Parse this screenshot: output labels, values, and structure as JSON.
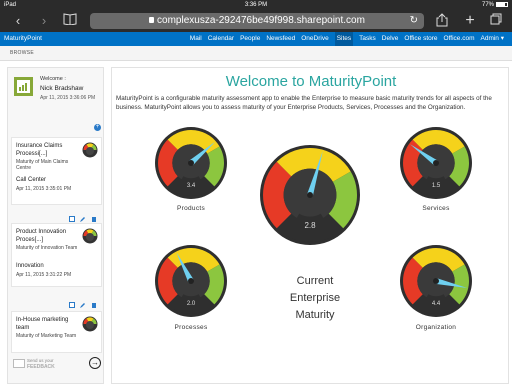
{
  "status": {
    "device": "iPad",
    "time": "3:36 PM",
    "battery": "77%"
  },
  "browser": {
    "url": "complexusza-292476be49f998.sharepoint.com"
  },
  "spnav": {
    "brand": "MaturityPoint",
    "links": [
      "Mail",
      "Calendar",
      "People",
      "Newsfeed",
      "OneDrive",
      "Sites",
      "Tasks",
      "Delve",
      "Office store",
      "Office.com",
      "Admin ▾"
    ],
    "active": "Sites"
  },
  "browse": "BROWSE",
  "welcome": {
    "label": "Welcome :",
    "name": "Nick Bradshaw",
    "date": "Apr 11, 2015 3:36:06 PM"
  },
  "assessments": [
    {
      "title": "Insurance Claims Processi[...]",
      "sub": "Maturity of Main Claims Centre",
      "category": "Call Center",
      "date": "Apr 11, 2015 3:35:01 PM"
    },
    {
      "title": "Product Innovation Proces[...]",
      "sub": "Maturity of Innovation Team",
      "category": "Innovation",
      "date": "Apr 11, 2015 3:31:22 PM"
    },
    {
      "title": "In-House marketing team",
      "sub": "Maturity of Marketing Team",
      "category": "",
      "date": ""
    }
  ],
  "feedback": {
    "line1": "Send us your",
    "line2": "FEEDBACK"
  },
  "main": {
    "title": "Welcome to MaturityPoint",
    "description": "MaturityPoint is a configurable maturity assessment app to enable the Enterprise to measure basic maturity trends for all aspects of the business. MaturityPoint allows you to assess maturity of your Enterprise Products, Services, Processes and the Organization.",
    "center_label": [
      "Current",
      "Enterprise",
      "Maturity"
    ]
  },
  "gauges": [
    {
      "id": "products",
      "label": "Products",
      "value": 3.4
    },
    {
      "id": "services",
      "label": "Services",
      "value": 1.5
    },
    {
      "id": "enterprise",
      "label": "",
      "value": 2.8
    },
    {
      "id": "processes",
      "label": "Processes",
      "value": 2.0
    },
    {
      "id": "organization",
      "label": "Organization",
      "value": 4.4
    }
  ],
  "colors": {
    "nav": "#0072c6",
    "title": "#2aa5a0",
    "red": "#e63a26",
    "yellow": "#f5d21b",
    "green": "#8cc63f",
    "needle": "#6fd0f0"
  }
}
